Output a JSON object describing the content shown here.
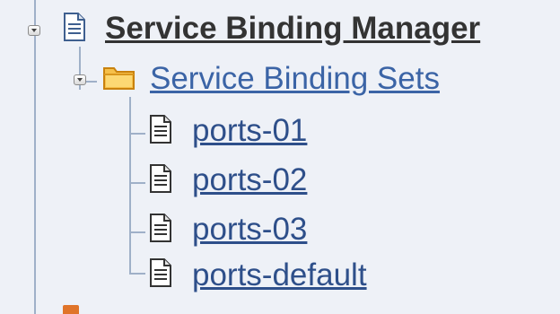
{
  "tree": {
    "root": {
      "label": "Service Binding Manager",
      "icon": "document-icon",
      "expanded": true
    },
    "folder": {
      "label": "Service Binding Sets",
      "icon": "folder-icon",
      "expanded": true
    },
    "leaves": [
      {
        "label": "ports-01",
        "icon": "document-icon"
      },
      {
        "label": "ports-02",
        "icon": "document-icon"
      },
      {
        "label": "ports-03",
        "icon": "document-icon"
      },
      {
        "label": "ports-default",
        "icon": "document-icon"
      }
    ]
  },
  "colors": {
    "background": "#eef1f7",
    "link": "#2e4f8a",
    "folder_link": "#3b64a6",
    "root_text": "#333333",
    "folder_icon": "#f2a31b"
  }
}
